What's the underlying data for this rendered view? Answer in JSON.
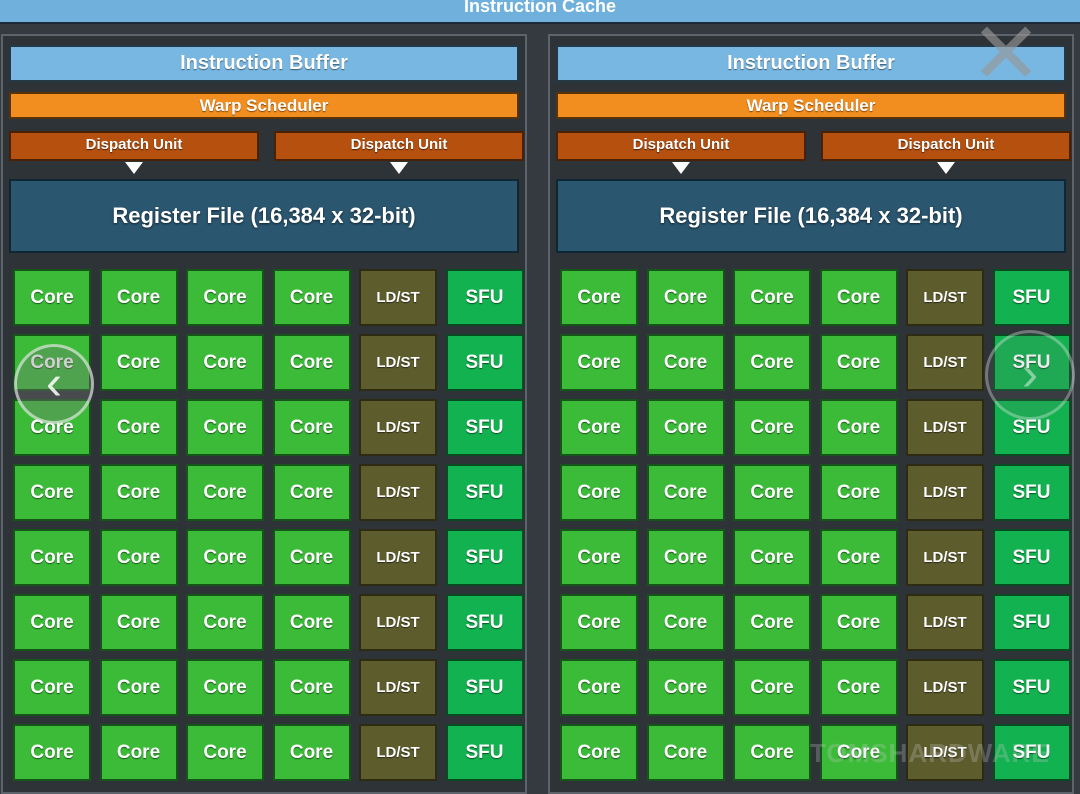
{
  "instruction_cache": "Instruction Cache",
  "sm_left": {
    "instruction_buffer": "Instruction Buffer",
    "warp_scheduler": "Warp Scheduler",
    "dispatch_units": [
      "Dispatch Unit",
      "Dispatch Unit"
    ],
    "register_file": "Register File (16,384 x 32-bit)",
    "rows": 8,
    "columns": [
      "Core",
      "Core",
      "Core",
      "Core",
      "LD/ST",
      "SFU"
    ]
  },
  "sm_right": {
    "instruction_buffer": "Instruction Buffer",
    "warp_scheduler": "Warp Scheduler",
    "dispatch_units": [
      "Dispatch Unit",
      "Dispatch Unit"
    ],
    "register_file": "Register File (16,384 x 32-bit)",
    "rows": 8,
    "columns": [
      "Core",
      "Core",
      "Core",
      "Core",
      "LD/ST",
      "SFU"
    ]
  },
  "overlay": {
    "prev_icon": "chevron-left-icon",
    "next_icon": "chevron-right-icon",
    "close_icon": "close-icon",
    "watermark": "TOMSHARDWARE"
  },
  "colors": {
    "core": "#3bbb38",
    "ldst": "#5d5c2d",
    "sfu": "#11b24f",
    "instruction_buffer": "#78b7e2",
    "warp_scheduler": "#f28d1f",
    "dispatch_unit": "#b5500f",
    "register_file": "#2a5670"
  }
}
